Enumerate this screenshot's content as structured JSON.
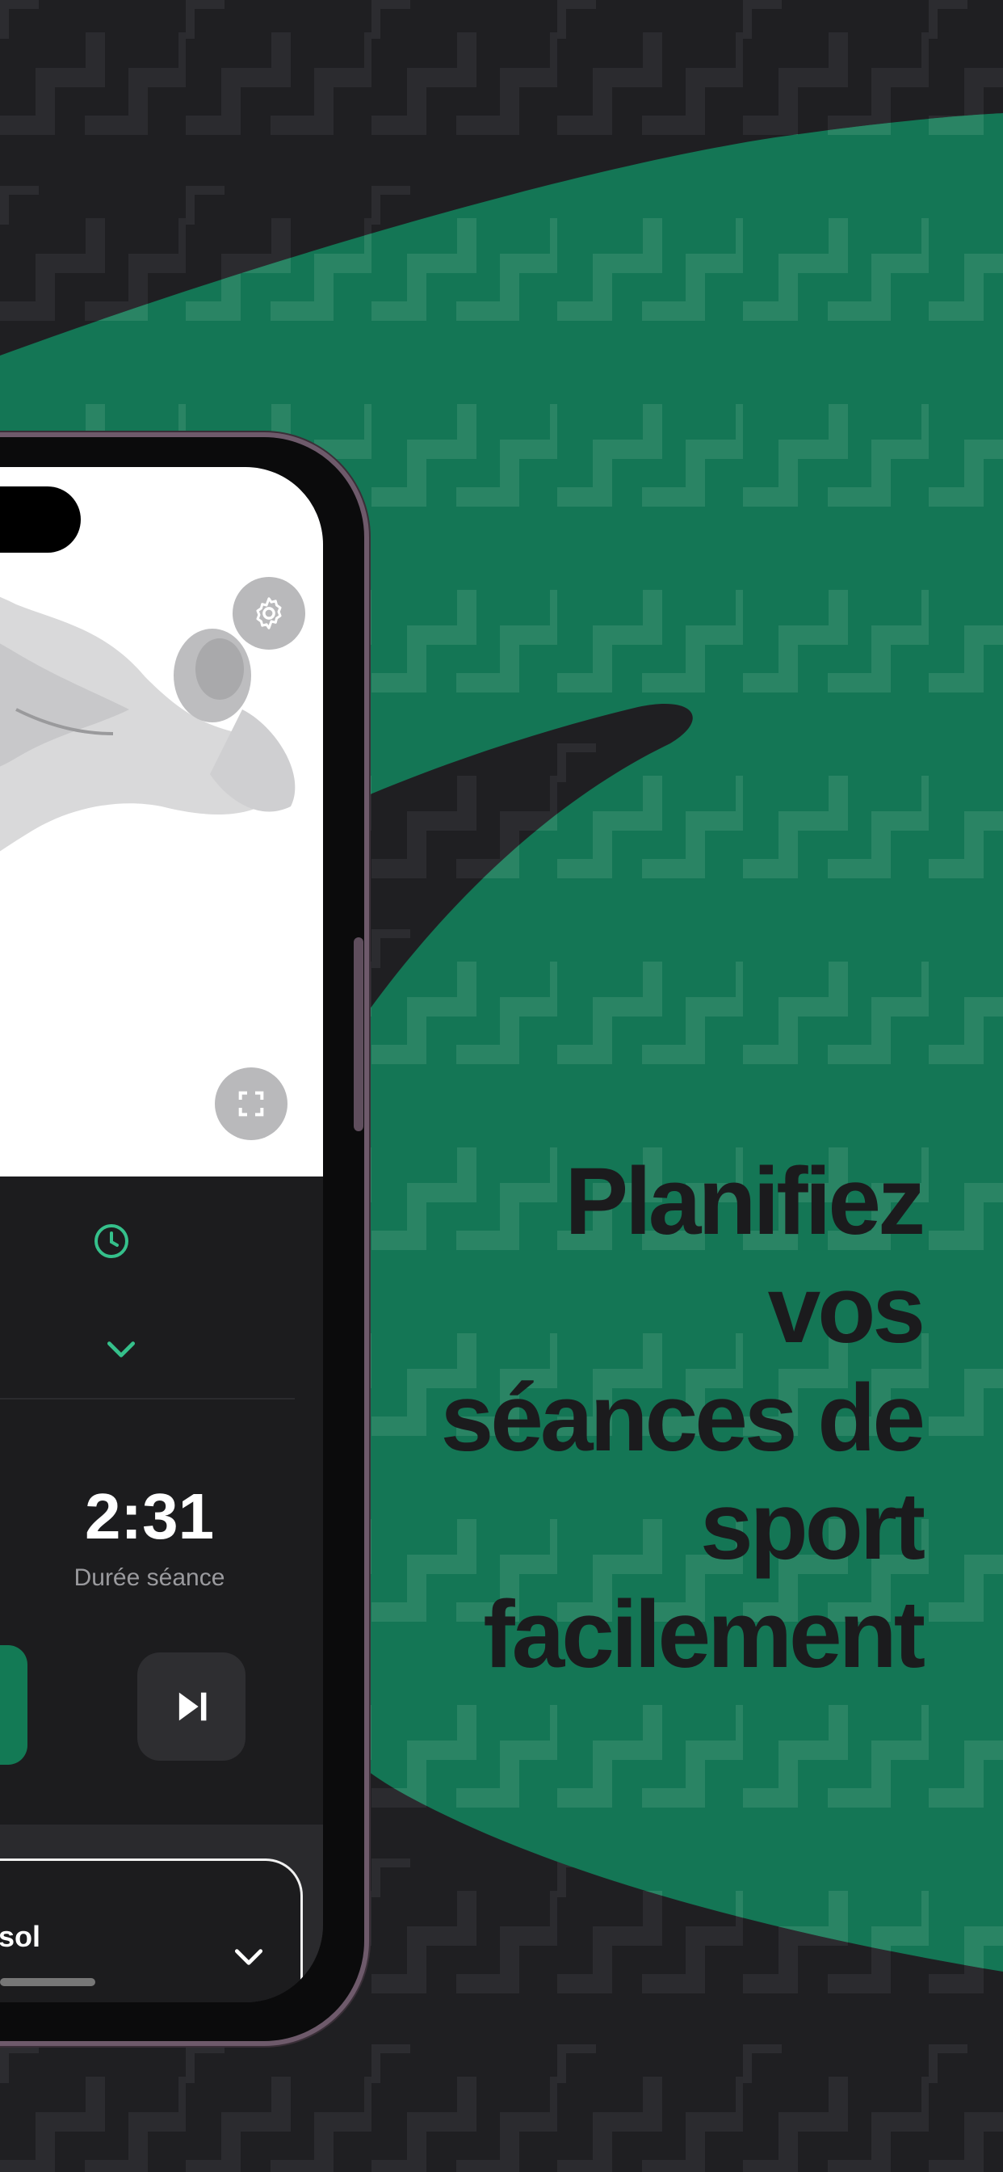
{
  "headline": {
    "lines": [
      "Planifiez",
      "vos",
      "séances de",
      "sport",
      "facilement"
    ]
  },
  "workout_screen": {
    "timer_value": "2:31",
    "timer_label": "Durée séance",
    "exercise_name_fragment": "sol"
  },
  "icons": {
    "settings": "gear-icon",
    "fullscreen": "fullscreen-icon",
    "clock": "clock-icon",
    "expand": "chevron-down-icon",
    "skip": "skip-next-icon",
    "collapse": "chevron-down-icon"
  },
  "colors": {
    "background": "#1f1f22",
    "accent_green": "#137a55",
    "icon_green": "#35c08b",
    "headline_text": "#1b1b1d"
  }
}
